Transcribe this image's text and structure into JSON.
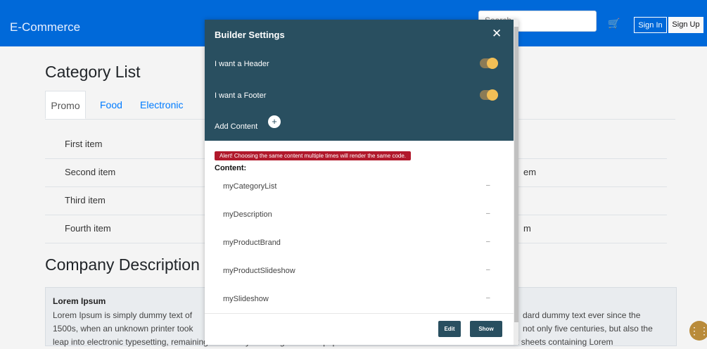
{
  "navbar": {
    "brand": "E-Commerce",
    "search_placeholder": "Search",
    "signin": "Sign In",
    "signup": "Sign Up"
  },
  "page": {
    "category_title": "Category List",
    "tabs": [
      "Promo",
      "Food",
      "Electronic"
    ],
    "list_items": [
      "First item",
      "Second item",
      "Third item",
      "Fourth item"
    ],
    "list_right": [
      "",
      "em",
      "",
      "m"
    ],
    "company_title": "Company Description",
    "card_title": "Lorem Ipsum",
    "card_text_1": "Lorem Ipsum is simply dummy text of",
    "card_text_1_right": "dard dummy text ever since the",
    "card_text_2": "1500s, when an unknown printer took",
    "card_text_2_right": "not only five centuries, but also the",
    "card_text_3": "leap into electronic typesetting, remaining essentially unchanged. It was popularised in the 1960s with the release of Letraset sheets containing Lorem"
  },
  "modal": {
    "title": "Builder Settings",
    "header_option": "I want a Header",
    "footer_option": "I want a Footer",
    "add_content": "Add Content",
    "alert": "Alert! Choosing the same content multiple times will render the same code.",
    "content_label": "Content:",
    "items": [
      "myCategoryList",
      "myDescription",
      "myProductBrand",
      "myProductSlideshow",
      "mySlideshow"
    ],
    "minus": "–",
    "edit_button": "Edit",
    "show_button": "Show"
  },
  "colors": {
    "navbar": "#0069d9",
    "modal_header": "#294f60",
    "toggle_knob": "#f2bf56",
    "alert": "#b1182b"
  }
}
